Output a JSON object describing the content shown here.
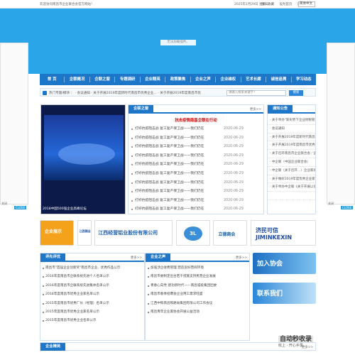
{
  "topbar": {
    "welcome": "欢迎访问南昌市企业联合会官方网站！",
    "date": "2025年1月29日 星期三",
    "links": [
      "加入收藏",
      "设为首页"
    ],
    "lang_label": "选择语言：",
    "lang_value": "简体中文"
  },
  "banner": {
    "plugin_text": "无法加载插件。"
  },
  "side_ads": {
    "close_label": "关闭",
    "badge": "CLOSE"
  },
  "nav": [
    "首 页",
    "企联概况",
    "企联之窗",
    "专题调研",
    "企业精英",
    "政策聚焦",
    "企业之声",
    "企业维权",
    "艺术长廊",
    "诚信追溯",
    "学习动态"
  ],
  "subbar": {
    "text": "热门专题/模块 ：  · 会议通知  · 关于开展2019年度新时代南昌市优秀企业...  · 关于开展2019年度南昌市优",
    "search_placeholder": "请输入搜索关键字！",
    "search_button": "搜索"
  },
  "photo": {
    "caption": "2018中国500强企业高峰论坛"
  },
  "news": {
    "title": "企联之窗",
    "more": "更多>>",
    "headline": "抗击疫情南昌企联在行动",
    "items": [
      {
        "t": "打好抗疫阻击战 复工复产保卫战——我们仍在",
        "d": "2020-06-29"
      },
      {
        "t": "打好抗疫阻击战 复工复产保卫战——我们仍在",
        "d": "2020-06-29"
      },
      {
        "t": "打好抗疫阻击战 复工复产保卫战——我们仍在",
        "d": "2020-06-29"
      },
      {
        "t": "打好抗疫阻击战 复工复产保卫战——我们仍在",
        "d": "2020-06-29"
      },
      {
        "t": "打好抗疫阻击战 复工复产保卫战——我们仍在",
        "d": "2020-06-29"
      },
      {
        "t": "打好抗疫阻击战 复工复产保卫战——我们仍在",
        "d": "2020-06-29"
      },
      {
        "t": "打好抗疫阻击战 复工复产保卫战——我们仍在",
        "d": "2020-06-29"
      },
      {
        "t": "打好抗疫阻击战 复工复产保卫战——我们仍在",
        "d": "2020-06-29"
      },
      {
        "t": "打好抗疫阻击战 复工复产保卫战——我们仍在",
        "d": "2020-06-29"
      },
      {
        "t": "打好抗疫阻击战 复工复产保卫战——我们仍在",
        "d": "2020-06-29"
      }
    ]
  },
  "notice": {
    "title": "通知公告",
    "items": [
      "· 关于举办\"新形势下企业财税管理\"",
      "· 会议通知",
      "· 关于开展2019年度新时代南昌市",
      "· 关于开展2019年度南昌市优秀企业",
      "· 关于召开南昌市企业联合会／企业家",
      "· 中企联（中国企业联合会）",
      "· 中企联（关于召开…）企业家培训",
      "· 关于做好2019年度优秀企业家推",
      "· 关于举办中企联《关于开展以创新','· 中企联（关于开展2019年度企业"
    ]
  },
  "logos": [
    "企业展示",
    "江西铜业",
    "江西经营铝业股份有限公司",
    "3L",
    "立德商会",
    "济民可信 JIMINKEXIN"
  ],
  "sec1": {
    "title": "评先评优",
    "more": "更多>>",
    "items": [
      "南昌市\"首届企业创新奖\"南昌市企业、优秀作品公示",
      "2016年度南昌市企联系统先进个人名单公示",
      "2016年度南昌市企联系统先进集体名单公示",
      "2016年度南昌市优秀企业家名单公示",
      "2015年度南昌市优秀厂长（经理）名单公示",
      "2015年度南昌市优秀企业家名单公示",
      "2015年度南昌市优秀企业名单公示"
    ]
  },
  "sec2": {
    "title": "企业之声",
    "more": "更多>>",
    "items": [
      "加强涉企收费管理,营造良好营商环境",
      "南昌市委制定出台若干措施支持民营企业发展",
      "青春心向党 建功新时代——南昌城投集团团委",
      "南昌市春季招聘会企业用工需求旺盛",
      "江西中铁南昌铁路局集团有限公司工作会议",
      "南昌青年企业家协会开展公益活动"
    ]
  },
  "side2": {
    "join": "加入协会",
    "contact": "联系我们"
  },
  "watermark": {
    "brand": "自动秒收录",
    "sub": "收上 · 开心手录"
  },
  "bottom": {
    "title": "企业精英",
    "more": "更多>>"
  }
}
